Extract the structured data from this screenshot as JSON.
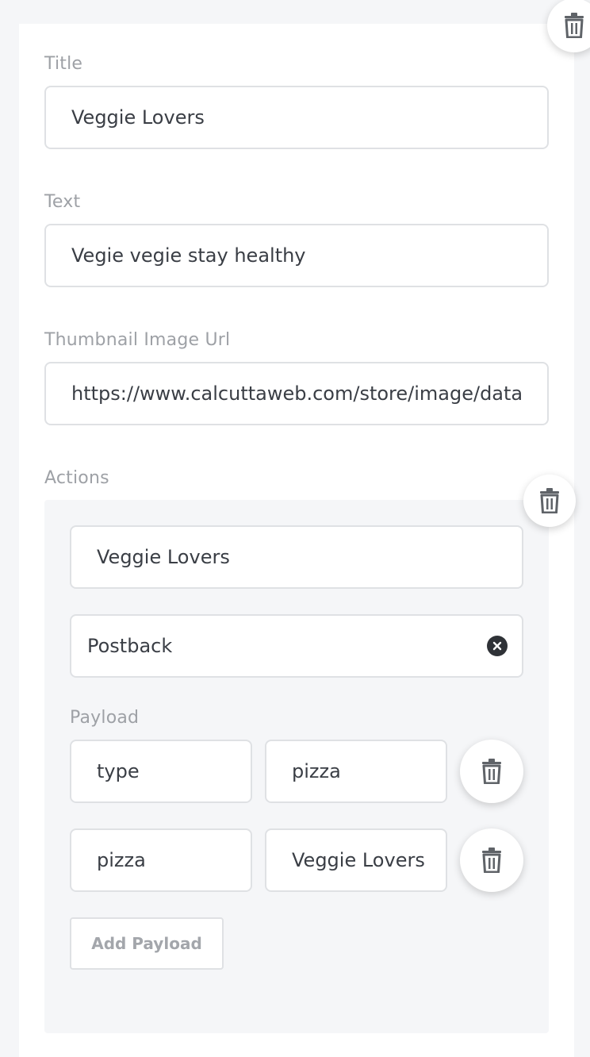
{
  "card": {
    "title_label": "Title",
    "title_value": "Veggie Lovers",
    "text_label": "Text",
    "text_value": "Vegie vegie stay healthy",
    "thumbnail_label": "Thumbnail Image Url",
    "thumbnail_value": "https://www.calcuttaweb.com/store/image/data",
    "actions_label": "Actions"
  },
  "action": {
    "title_value": "Veggie Lovers",
    "type_value": "Postback",
    "payload_label": "Payload",
    "payload": [
      {
        "key": "type",
        "value": "pizza"
      },
      {
        "key": "pizza",
        "value": "Veggie Lovers"
      }
    ],
    "add_payload_label": "Add Payload"
  },
  "icons": {
    "delete": "trash-icon",
    "clear": "close-circle-icon"
  },
  "colors": {
    "page_bg": "#f5f6f8",
    "card_bg": "#ffffff",
    "border": "#dfe1e4",
    "label": "#9ea1a6",
    "text": "#3a3e45",
    "icon": "#5f6368"
  }
}
